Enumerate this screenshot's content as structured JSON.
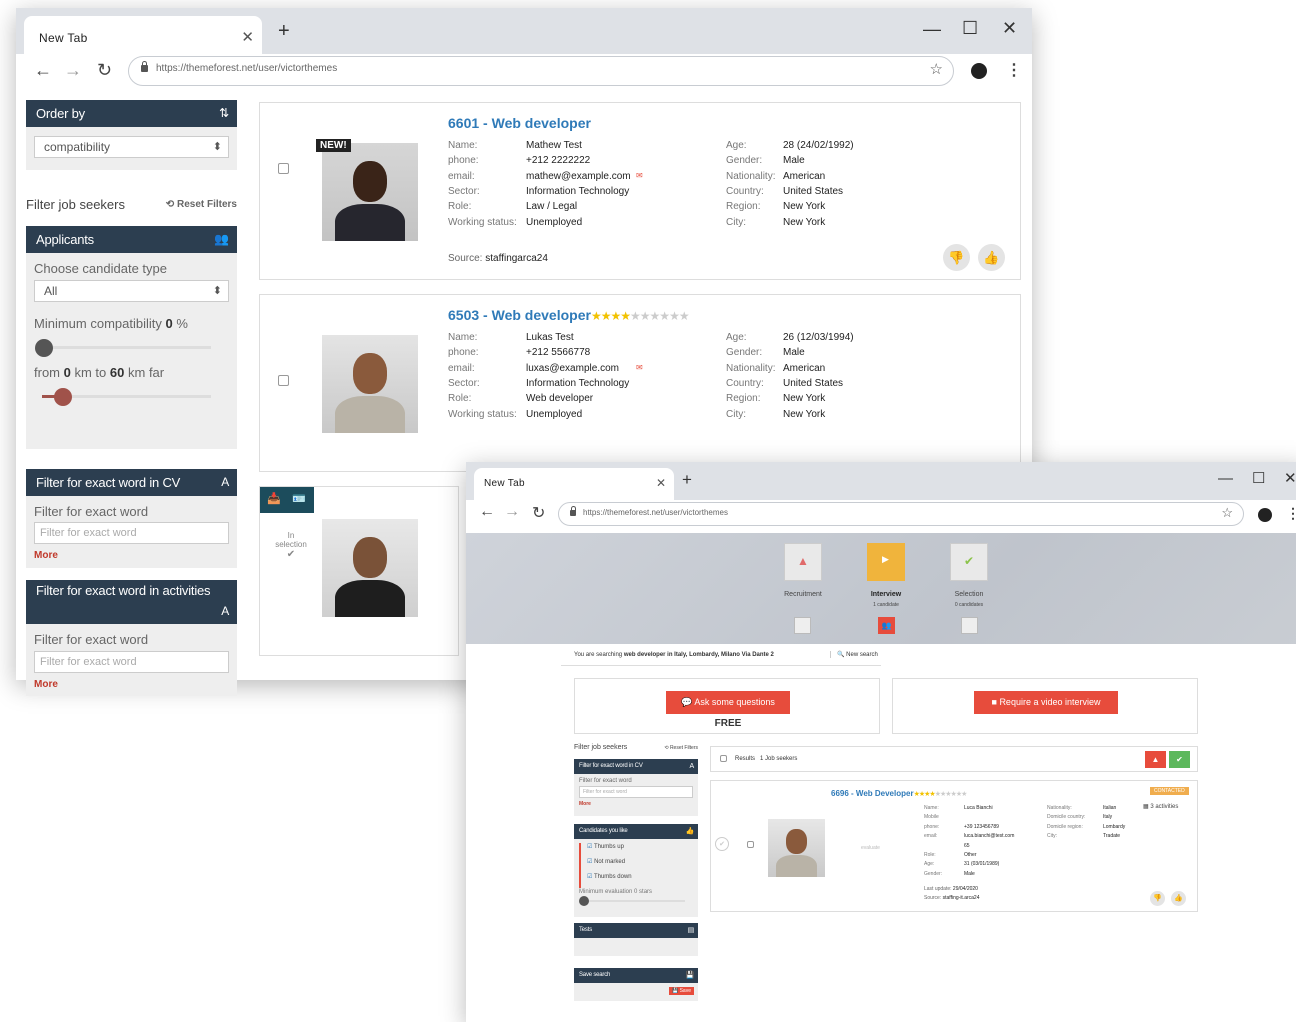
{
  "browser": {
    "tab_title": "New Tab",
    "url": "https://themeforest.net/user/victorthemes"
  },
  "sidebar": {
    "order_by": {
      "title": "Order by",
      "value": "compatibility"
    },
    "filter_title": "Filter job seekers",
    "reset": "Reset Filters",
    "applicants": {
      "title": "Applicants",
      "choose_label": "Choose candidate type",
      "type_value": "All",
      "compat_prefix": "Minimum compatibility",
      "compat_value": "0",
      "compat_unit": "%",
      "compat_level": 0,
      "dist_from": "from",
      "dist_min": "0",
      "dist_mid": "km to",
      "dist_max": "60",
      "dist_suffix": "km far"
    },
    "cv_filter": {
      "title": "Filter for exact word in CV",
      "label": "Filter for exact word",
      "placeholder": "Filter for exact word",
      "more": "More"
    },
    "act_filter": {
      "title": "Filter for exact word in activities",
      "label": "Filter for exact word",
      "placeholder": "Filter for exact word",
      "more": "More"
    }
  },
  "candidates": [
    {
      "id": "6601",
      "sep": " - ",
      "role_title": "Web developer",
      "badge": "NEW!",
      "stars": 0,
      "left": [
        [
          "Name:",
          "Mathew Test"
        ],
        [
          "phone:",
          "+212 2222222"
        ],
        [
          "email:",
          "mathew@example.com"
        ],
        [
          "Sector:",
          "Information Technology"
        ],
        [
          "Role:",
          "Law / Legal"
        ],
        [
          "Working status:",
          "Unemployed"
        ]
      ],
      "right": [
        [
          "Age:",
          "28 (24/02/1992)"
        ],
        [
          "Gender:",
          "Male"
        ],
        [
          "Nationality:",
          "American"
        ],
        [
          "Country:",
          "United States"
        ],
        [
          "Region:",
          "New York"
        ],
        [
          "City:",
          "New York"
        ]
      ],
      "source_label": "Source:",
      "source": "staffingarca24"
    },
    {
      "id": "6503",
      "sep": " - ",
      "role_title": "Web developer",
      "stars": 4,
      "left": [
        [
          "Name:",
          "Lukas Test"
        ],
        [
          "phone:",
          "+212 5566778"
        ],
        [
          "email:",
          "luxas@example.com"
        ],
        [
          "Sector:",
          "Information Technology"
        ],
        [
          "Role:",
          "Web developer"
        ],
        [
          "Working status:",
          "Unemployed"
        ]
      ],
      "right": [
        [
          "Age:",
          "26 (12/03/1994)"
        ],
        [
          "Gender:",
          "Male"
        ],
        [
          "Nationality:",
          "American"
        ],
        [
          "Country:",
          "United States"
        ],
        [
          "Region:",
          "New York"
        ],
        [
          "City:",
          "New York"
        ]
      ]
    }
  ],
  "selection_tag": {
    "line1": "In",
    "line2": "selection"
  },
  "w2": {
    "steps": [
      {
        "label": "Recruitment",
        "sub": ""
      },
      {
        "label": "Interview",
        "sub": "1 candidate"
      },
      {
        "label": "Selection",
        "sub": "0 candidates"
      }
    ],
    "searching_prefix": "You are searching",
    "searching_query": "web developer in Italy, Lombardy, Milano Via Dante 2",
    "new_search": "New search",
    "ask_btn": "Ask some questions",
    "free": "FREE",
    "video_btn": "Require a video interview",
    "filter_title": "Filter job seekers",
    "reset": "Reset Filters",
    "cv_title": "Filter for exact word in CV",
    "cv_label": "Filter for exact word",
    "cv_placeholder": "Filter for exact word",
    "more": "More",
    "likes_title": "Candidates you like",
    "likes": [
      "Thumbs up",
      "Not marked",
      "Thumbs down"
    ],
    "min_eval": "Minimum evaluation 0 stars",
    "tests": "Tests",
    "save_search": "Save search",
    "save": "Save",
    "results_label": "Results",
    "results_count": "1 Job seekers",
    "cand": {
      "id": "6696",
      "sep": " - ",
      "role_title": "Web Developer",
      "stars": 4,
      "status": "CONTACTED",
      "activities": "3 activities",
      "evaluate": "evaluate",
      "left": [
        [
          "Name:",
          "Luca Bianchi"
        ],
        [
          "Mobile",
          ""
        ],
        [
          "phone:",
          "+39 123456789"
        ],
        [
          "email:",
          "luca.bianchi@test.com"
        ],
        [
          "",
          "65"
        ],
        [
          "Role:",
          "Other"
        ],
        [
          "Age:",
          "31 (03/01/1989)"
        ],
        [
          "Gender:",
          "Male"
        ]
      ],
      "right": [
        [
          "Nationality:",
          "Italian"
        ],
        [
          "Domicile country:",
          "Italy"
        ],
        [
          "Domicile region:",
          "Lombardy"
        ],
        [
          "City:",
          "Tradate"
        ]
      ],
      "last_update_label": "Last update:",
      "last_update": "29/04/2020",
      "source_label": "Source:",
      "source": "staffing-it.arca24"
    }
  },
  "colors": {
    "panel_head": "#2c3e50",
    "link": "#2f7ab8",
    "accent_red": "#e74c3c",
    "star": "#f2c200",
    "step_active": "#f0b43c"
  }
}
